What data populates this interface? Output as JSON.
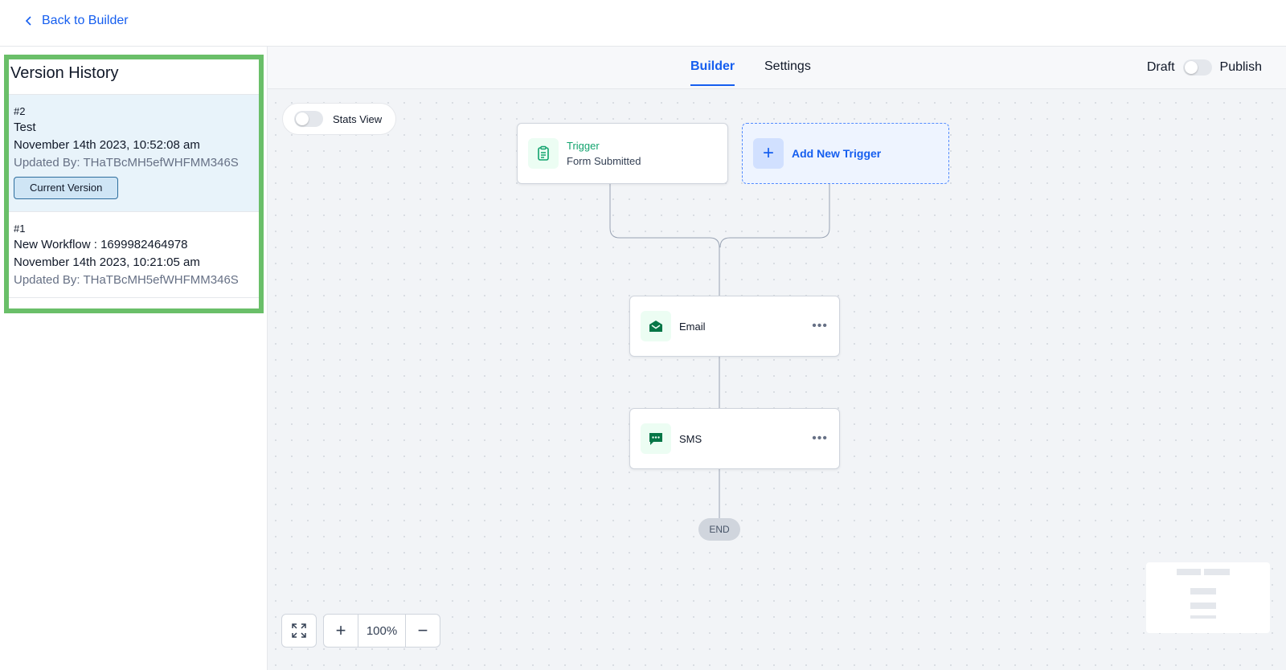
{
  "topbar": {
    "back_label": "Back to Builder"
  },
  "sidebar": {
    "title": "Version History",
    "versions": [
      {
        "number": "#2",
        "name": "Test",
        "date": "November 14th 2023, 10:52:08 am",
        "updated_by": "Updated By: THaTBcMH5efWHFMM346S",
        "badge": "Current Version"
      },
      {
        "number": "#1",
        "name": "New Workflow : 1699982464978",
        "date": "November 14th 2023, 10:21:05 am",
        "updated_by": "Updated By: THaTBcMH5efWHFMM346S"
      }
    ]
  },
  "header": {
    "tabs": [
      {
        "label": "Builder",
        "active": true
      },
      {
        "label": "Settings",
        "active": false
      }
    ],
    "draft_label": "Draft",
    "publish_label": "Publish"
  },
  "canvas": {
    "stats_view_label": "Stats View",
    "trigger": {
      "title": "Trigger",
      "subtitle": "Form Submitted"
    },
    "add_trigger_label": "Add New Trigger",
    "actions": [
      {
        "label": "Email",
        "icon": "email-icon"
      },
      {
        "label": "SMS",
        "icon": "sms-icon"
      }
    ],
    "end_label": "END",
    "zoom": {
      "value": "100%"
    }
  },
  "colors": {
    "accent": "#155eef",
    "success": "#12a36e",
    "highlight_border": "#6abf69"
  }
}
